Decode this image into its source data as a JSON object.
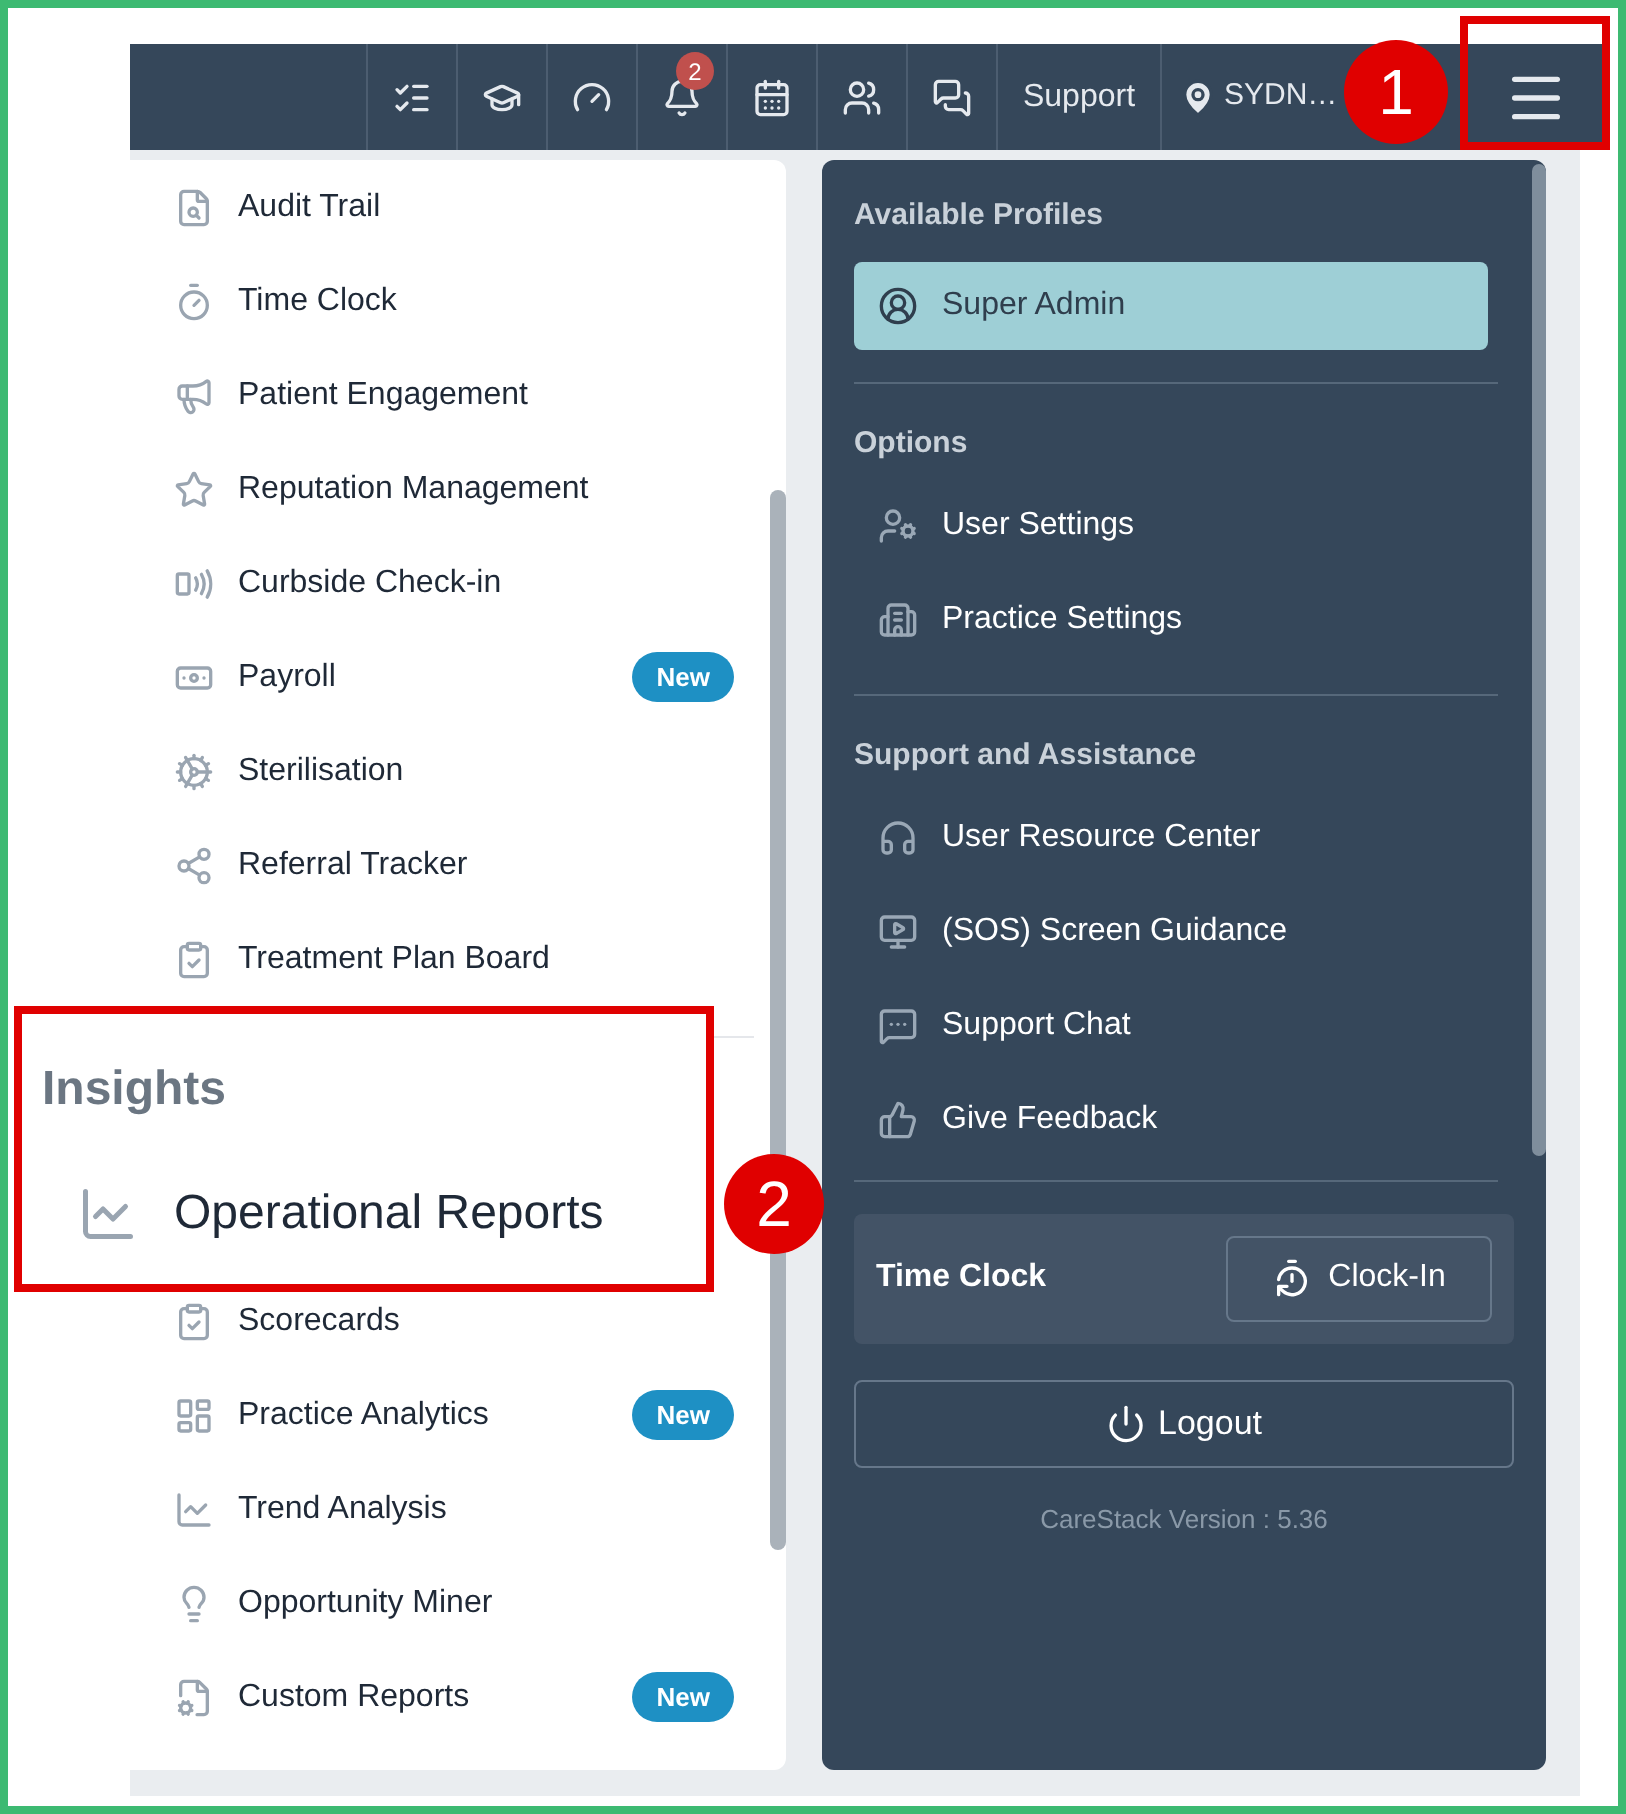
{
  "topbar": {
    "notification_badge": "2",
    "support": "Support",
    "location": "SYDN…"
  },
  "left_menu": {
    "items": [
      {
        "label": "Audit Trail"
      },
      {
        "label": "Time Clock"
      },
      {
        "label": "Patient Engagement"
      },
      {
        "label": "Reputation Management"
      },
      {
        "label": "Curbside Check-in"
      },
      {
        "label": "Payroll",
        "badge": "New"
      },
      {
        "label": "Sterilisation"
      },
      {
        "label": "Referral Tracker"
      },
      {
        "label": "Treatment Plan Board"
      }
    ],
    "insights_items": [
      {
        "label": "Scorecards"
      },
      {
        "label": "Practice Analytics",
        "badge": "New"
      },
      {
        "label": "Trend Analysis"
      },
      {
        "label": "Opportunity Miner"
      },
      {
        "label": "Custom Reports",
        "badge": "New"
      }
    ]
  },
  "zoom_callout": {
    "heading": "Insights",
    "item": "Operational Reports"
  },
  "account_menu": {
    "profiles_heading": "Available Profiles",
    "profiles": [
      {
        "label": "Super Admin",
        "selected": true
      }
    ],
    "options_heading": "Options",
    "options": [
      {
        "label": "User Settings"
      },
      {
        "label": "Practice Settings"
      }
    ],
    "support_heading": "Support and Assistance",
    "support": [
      {
        "label": "User Resource Center"
      },
      {
        "label": "(SOS) Screen Guidance"
      },
      {
        "label": "Support Chat"
      },
      {
        "label": "Give Feedback"
      }
    ],
    "time_clock": {
      "label": "Time Clock",
      "button": "Clock-In"
    },
    "logout": "Logout",
    "version": "CareStack Version : 5.36"
  },
  "annotations": [
    {
      "label": "1"
    },
    {
      "label": "2"
    }
  ]
}
